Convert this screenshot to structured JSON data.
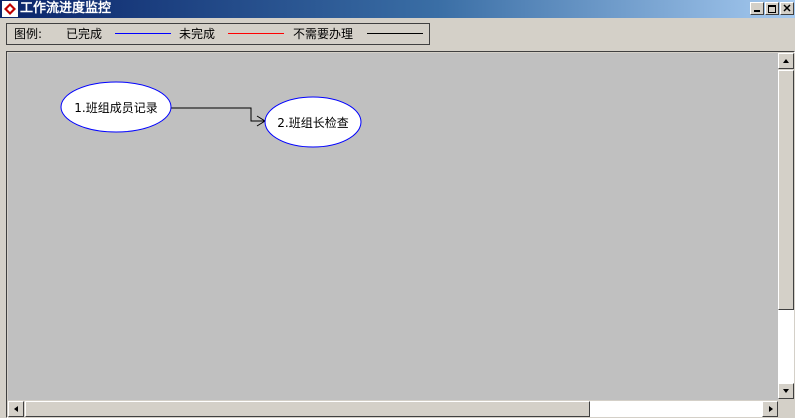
{
  "window": {
    "title": "工作流进度监控"
  },
  "legend": {
    "label": "图例:",
    "items": [
      {
        "label": "已完成",
        "color": "#0000ff"
      },
      {
        "label": "未完成",
        "color": "#ff0000"
      },
      {
        "label": "不需要办理",
        "color": "#000000"
      }
    ]
  },
  "workflow": {
    "nodes": [
      {
        "label": "1.班组成员记录"
      },
      {
        "label": "2.班组长检查"
      }
    ]
  },
  "colors": {
    "node_border": "#0000ff",
    "edge": "#000000",
    "canvas": "#c0c0c0"
  },
  "icons": [
    "app-icon",
    "minimize-icon",
    "maximize-icon",
    "close-icon",
    "scroll-up-icon",
    "scroll-down-icon",
    "scroll-left-icon",
    "scroll-right-icon"
  ]
}
